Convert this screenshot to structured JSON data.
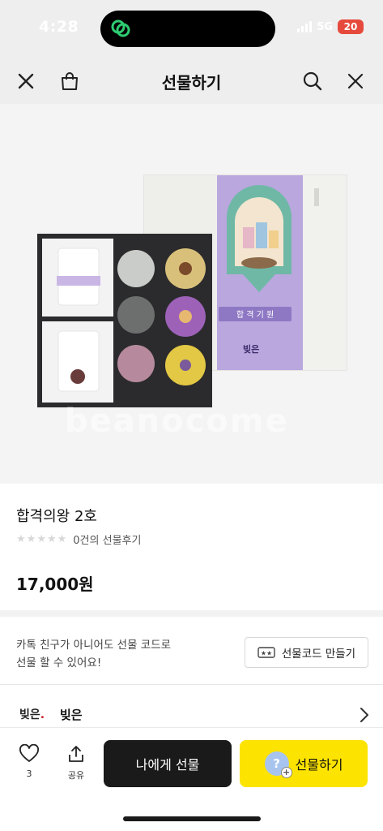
{
  "status_bar": {
    "time": "4:28",
    "network": "5G",
    "battery": "20"
  },
  "header": {
    "title": "선물하기",
    "icons": [
      "close-icon",
      "bag-icon",
      "search-icon",
      "close-icon"
    ]
  },
  "product": {
    "image_watermark": "beanocome",
    "name": "합격의왕 2호",
    "rating": 0,
    "review_text": "0건의 선물후기",
    "price": "17,000원"
  },
  "gift_note": {
    "line1": "카톡 친구가 아니어도 선물 코드로",
    "line2": "선물 할 수 있어요!",
    "code_button": "선물코드 만들기"
  },
  "brand": {
    "logo_text": "빚은",
    "name": "빚은"
  },
  "bottom_bar": {
    "like_count": "3",
    "share_label": "공유",
    "self_gift_button": "나에게 선물",
    "gift_button": "선물하기",
    "gift_button_color": "#fde300"
  }
}
